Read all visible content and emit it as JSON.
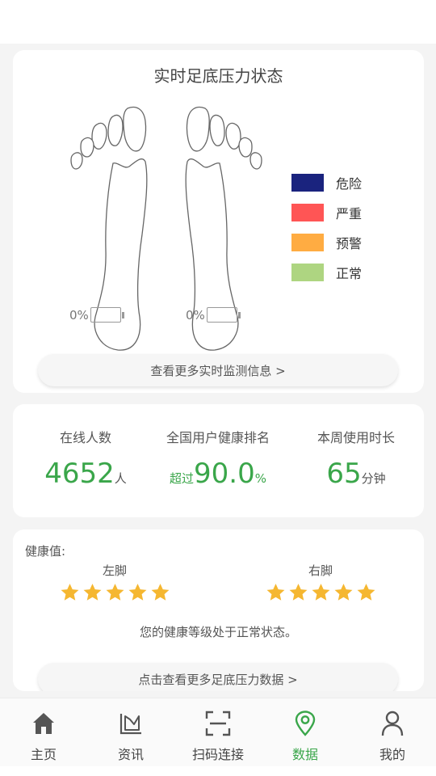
{
  "realtime": {
    "title": "实时足底压力状态",
    "left_battery": "0%",
    "right_battery": "0%",
    "legend": [
      {
        "label": "危险",
        "color": "#1a237e"
      },
      {
        "label": "严重",
        "color": "#ff5555"
      },
      {
        "label": "预警",
        "color": "#ffac42"
      },
      {
        "label": "正常",
        "color": "#aed581"
      }
    ],
    "more_button": "查看更多实时监测信息 >"
  },
  "stats": {
    "online": {
      "label": "在线人数",
      "value": "4652",
      "unit": "人"
    },
    "rank": {
      "label": "全国用户健康排名",
      "prefix": "超过",
      "value": "90.0",
      "unit": "%"
    },
    "usage": {
      "label": "本周使用时长",
      "value": "65",
      "unit": "分钟"
    },
    "accent_color": "#3aa64a"
  },
  "health": {
    "title": "健康值:",
    "left_label": "左脚",
    "right_label": "右脚",
    "left_stars": 5,
    "right_stars": 5,
    "star_color": "#f5b731",
    "status": "您的健康等级处于正常状态。",
    "more_button": "点击查看更多足底压力数据 >"
  },
  "nav": {
    "items": [
      {
        "label": "主页",
        "icon": "home-icon"
      },
      {
        "label": "资讯",
        "icon": "chart-icon"
      },
      {
        "label": "扫码连接",
        "icon": "scan-icon"
      },
      {
        "label": "数据",
        "icon": "location-pin-icon",
        "active": true
      },
      {
        "label": "我的",
        "icon": "user-icon"
      }
    ]
  }
}
